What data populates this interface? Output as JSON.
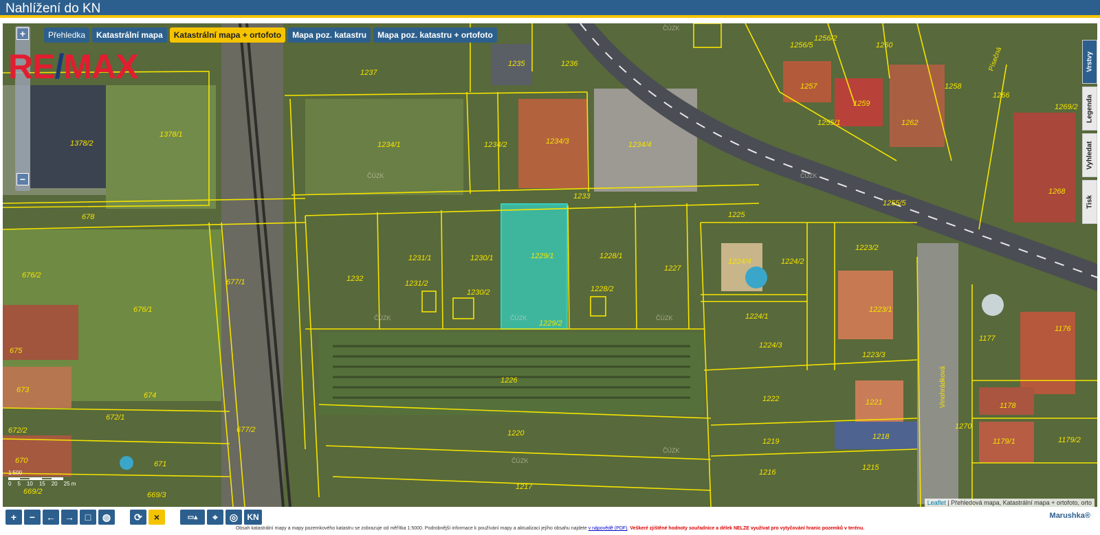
{
  "app": {
    "title": "Nahlížení do KN"
  },
  "layers": {
    "tabs": [
      {
        "label": "Přehledka"
      },
      {
        "label": "Katastrální mapa"
      },
      {
        "label": "Katastrální mapa + ortofoto"
      },
      {
        "label": "Mapa poz. katastru"
      },
      {
        "label": "Mapa poz. katastru + ortofoto"
      }
    ],
    "active_index": 2
  },
  "logo": {
    "part1": "RE",
    "slash": "/",
    "part2": "MAX"
  },
  "side_tabs": [
    "Vrstvy",
    "Legenda",
    "Vyhledat",
    "Tisk"
  ],
  "zoom": {
    "in": "+",
    "out": "−"
  },
  "scale": {
    "ratio": "1:500",
    "ticks": [
      "0",
      "5",
      "10",
      "15",
      "20",
      "25 m"
    ]
  },
  "parcels": [
    "1237",
    "1235",
    "1236",
    "1234/1",
    "1234/2",
    "1234/3",
    "1234/4",
    "1378/1",
    "1378/2",
    "1233",
    "678",
    "1232",
    "1231/1",
    "1231/2",
    "1230/1",
    "1230/2",
    "1229/1",
    "1229/2",
    "1228/1",
    "1228/2",
    "1227",
    "1225",
    "1224/4",
    "1224/2",
    "1224/1",
    "1224/3",
    "1223/2",
    "1223/1",
    "1223/3",
    "1226",
    "1222",
    "1221",
    "1220",
    "1219",
    "1218",
    "1217",
    "1216",
    "1215",
    "1177",
    "1176",
    "1178",
    "1179/1",
    "1179/2",
    "676/2",
    "676/1",
    "677/1",
    "677/2",
    "675",
    "674",
    "673",
    "672/1",
    "672/2",
    "671",
    "670",
    "669/2",
    "669/3",
    "1260",
    "1256/5",
    "1256/2",
    "1257",
    "1259",
    "1258",
    "1262",
    "1266",
    "1269/2",
    "1268",
    "1255/1",
    "1255/5",
    "1270"
  ],
  "street_labels": [
    "Písečná",
    "Vinohrádková"
  ],
  "watermark": "ČÚZK",
  "selected_color": "#35d0c0",
  "parcel_line_color": "#f5e400",
  "toolbar": {
    "buttons": [
      "+",
      "−",
      "←",
      "→",
      "□",
      "globe",
      "refresh",
      "×",
      "measure",
      "pin",
      "locate",
      "KN"
    ]
  },
  "attribution": {
    "leaflet": "Leaflet",
    "text": "| Přehledová mapa, Katastrální mapa + ortofoto, orto"
  },
  "brand": "Marushka®",
  "footer": {
    "text": "Obsah katastrální mapy a mapy pozemkového katastru se zobrazuje od měřítka 1:5000. Podrobnější informace k používání mapy a aktualizaci jejího obsahu najdete",
    "link": "v nápovědě (PDF)",
    "warning": "Veškeré zjištěné hodnoty souřadnice a délek NELZE využívat pro vytyčování hranic pozemků v terénu."
  }
}
